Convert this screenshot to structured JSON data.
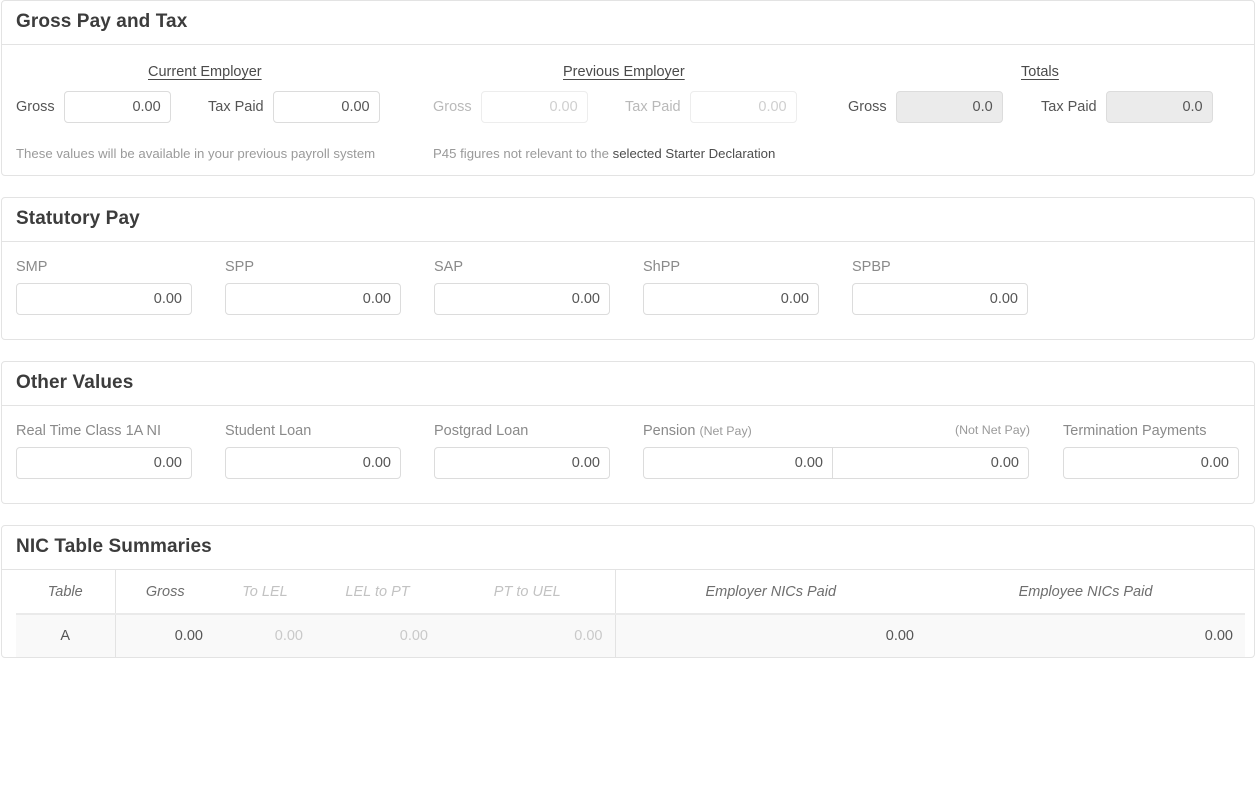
{
  "sections": {
    "gross_pay_tax": {
      "title": "Gross Pay and Tax",
      "columns": {
        "current": "Current Employer",
        "previous": "Previous Employer",
        "totals": "Totals"
      },
      "current": {
        "gross_label": "Gross",
        "gross_value": "0.00",
        "tax_label": "Tax Paid",
        "tax_value": "0.00",
        "helper": "These values will be available in your previous payroll system"
      },
      "previous": {
        "gross_label": "Gross",
        "gross_placeholder": "0.00",
        "tax_label": "Tax Paid",
        "tax_placeholder": "0.00",
        "helper_plain": "P45 figures not relevant to the ",
        "helper_strong": "selected Starter Declaration"
      },
      "totals": {
        "gross_label": "Gross",
        "gross_value": "0.0",
        "tax_label": "Tax Paid",
        "tax_value": "0.0"
      }
    },
    "statutory_pay": {
      "title": "Statutory Pay",
      "fields": [
        {
          "label": "SMP",
          "value": "0.00"
        },
        {
          "label": "SPP",
          "value": "0.00"
        },
        {
          "label": "SAP",
          "value": "0.00"
        },
        {
          "label": "ShPP",
          "value": "0.00"
        },
        {
          "label": "SPBP",
          "value": "0.00"
        }
      ]
    },
    "other_values": {
      "title": "Other Values",
      "fields": [
        {
          "label": "Real Time Class 1A NI",
          "value": "0.00"
        },
        {
          "label": "Student Loan",
          "value": "0.00"
        },
        {
          "label": "Postgrad Loan",
          "value": "0.00"
        }
      ],
      "pension": {
        "label_main": "Pension",
        "label_sub": "(Net Pay)",
        "label_right": "(Not Net Pay)",
        "net_pay_value": "0.00",
        "not_net_pay_value": "0.00"
      },
      "termination": {
        "label": "Termination Payments",
        "value": "0.00"
      }
    },
    "nic_table_summaries": {
      "title": "NIC Table Summaries",
      "headers": [
        "Table",
        "Gross",
        "To LEL",
        "LEL to PT",
        "PT to UEL",
        "Employer NICs Paid",
        "Employee NICs Paid"
      ],
      "rows": [
        {
          "table": "A",
          "gross": "0.00",
          "to_lel": "0.00",
          "lel_to_pt": "0.00",
          "pt_to_uel": "0.00",
          "employer_nics_paid": "0.00",
          "employee_nics_paid": "0.00"
        }
      ]
    }
  },
  "colors": {
    "card_border": "#e3e3e3",
    "heading": "#3c3c3c",
    "muted_text": "#b9b9b9",
    "disabled_bg": "#ebebeb",
    "row_bg": "#f9f9f9"
  }
}
